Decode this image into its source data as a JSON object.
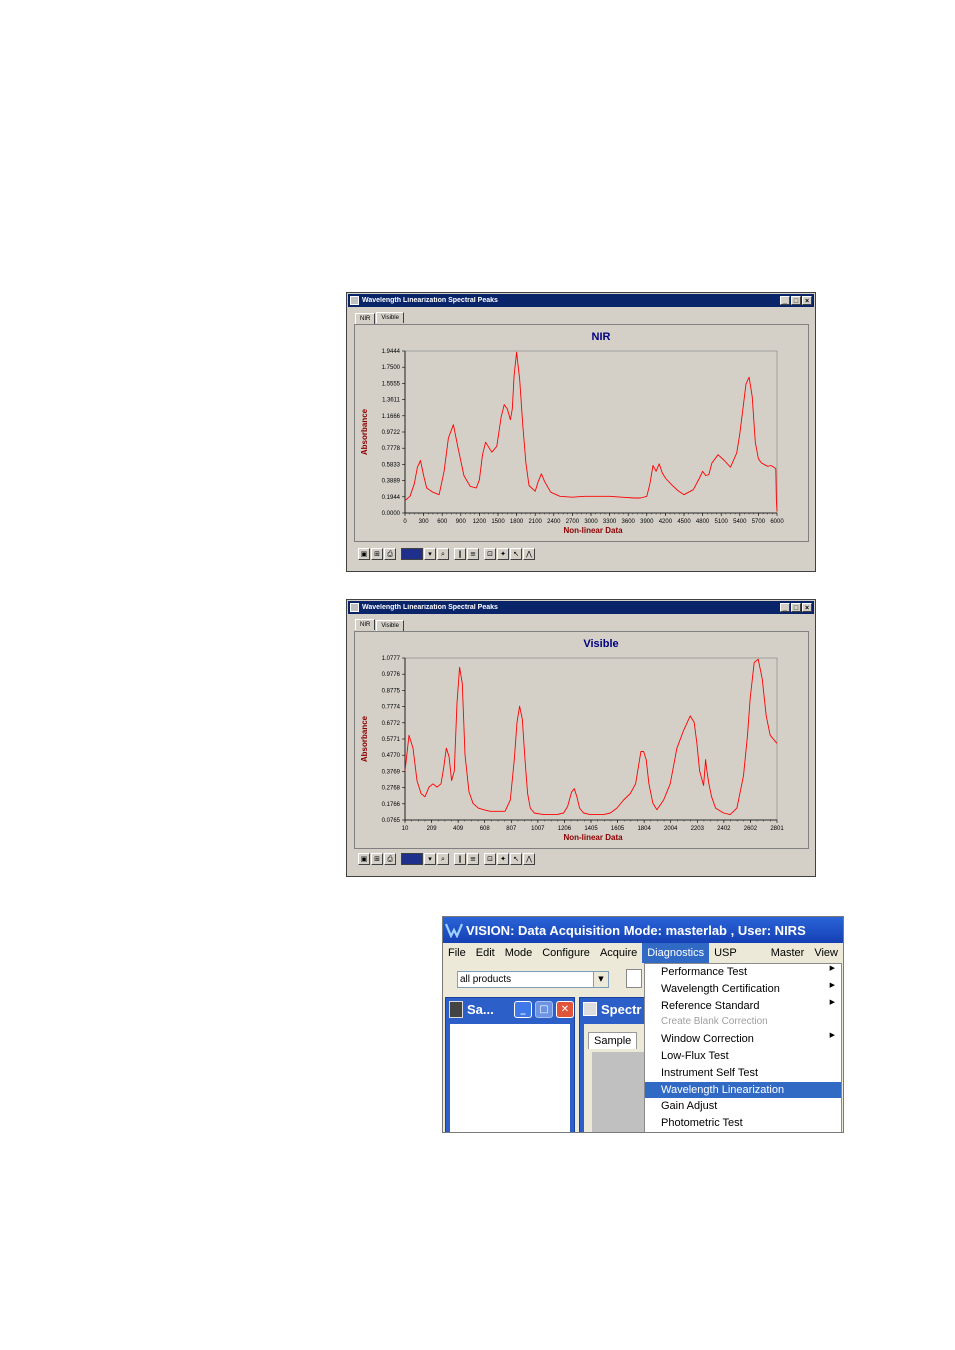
{
  "window_title": "Wavelength Linearization Spectral Peaks",
  "tabs": [
    "NIR",
    "Visible"
  ],
  "nir_chart": {
    "title": "NIR",
    "ylabel": "Absorbance",
    "xlabel": "Non-linear Data",
    "yticks": [
      "1.9444",
      "1.7500",
      "1.5555",
      "1.3611",
      "1.1666",
      "0.9722",
      "0.7778",
      "0.5833",
      "0.3889",
      "0.1944",
      "0.0000"
    ],
    "xticks": [
      "0",
      "300",
      "600",
      "900",
      "1200",
      "1500",
      "1800",
      "2100",
      "2400",
      "2700",
      "3000",
      "3300",
      "3600",
      "3900",
      "4200",
      "4500",
      "4800",
      "5100",
      "5400",
      "5700",
      "6000"
    ]
  },
  "visible_chart": {
    "title": "Visible",
    "ylabel": "Absorbance",
    "xlabel": "Non-linear Data",
    "yticks": [
      "1.0777",
      "0.9776",
      "0.8775",
      "0.7774",
      "0.6772",
      "0.5771",
      "0.4770",
      "0.3769",
      "0.2768",
      "0.1766",
      "0.0765"
    ],
    "xticks": [
      "10",
      "209",
      "409",
      "608",
      "807",
      "1007",
      "1206",
      "1405",
      "1605",
      "1804",
      "2004",
      "2203",
      "2402",
      "2602",
      "2801"
    ]
  },
  "chart_data": [
    {
      "type": "line",
      "title": "NIR",
      "xlabel": "Non-linear Data",
      "ylabel": "Absorbance",
      "xlim": [
        0,
        6000
      ],
      "ylim": [
        0,
        1.9444
      ],
      "grid": false,
      "series": [
        {
          "color": "#ff0000",
          "x": [
            0,
            80,
            150,
            200,
            250,
            300,
            350,
            450,
            550,
            630,
            700,
            780,
            850,
            950,
            1050,
            1150,
            1200,
            1250,
            1300,
            1400,
            1480,
            1550,
            1600,
            1650,
            1700,
            1730,
            1760,
            1800,
            1850,
            1900,
            1950,
            2000,
            2100,
            2150,
            2200,
            2250,
            2350,
            2500,
            2700,
            2900,
            3100,
            3300,
            3500,
            3700,
            3800,
            3900,
            3950,
            4000,
            4050,
            4100,
            4150,
            4200,
            4300,
            4400,
            4500,
            4650,
            4750,
            4800,
            4850,
            4900,
            4950,
            5050,
            5150,
            5250,
            5350,
            5400,
            5450,
            5500,
            5550,
            5600,
            5650,
            5700,
            5750,
            5800,
            5850,
            5900,
            5950,
            5980,
            5990,
            6000
          ],
          "y": [
            0.15,
            0.2,
            0.35,
            0.55,
            0.63,
            0.45,
            0.3,
            0.25,
            0.22,
            0.5,
            0.9,
            1.06,
            0.8,
            0.45,
            0.32,
            0.3,
            0.4,
            0.7,
            0.85,
            0.73,
            0.8,
            1.15,
            1.3,
            1.25,
            1.12,
            1.25,
            1.65,
            1.93,
            1.6,
            1.05,
            0.6,
            0.33,
            0.26,
            0.38,
            0.47,
            0.38,
            0.25,
            0.2,
            0.19,
            0.2,
            0.2,
            0.2,
            0.19,
            0.18,
            0.18,
            0.2,
            0.35,
            0.57,
            0.5,
            0.59,
            0.48,
            0.42,
            0.34,
            0.27,
            0.22,
            0.28,
            0.42,
            0.5,
            0.45,
            0.46,
            0.6,
            0.7,
            0.63,
            0.55,
            0.72,
            0.95,
            1.25,
            1.55,
            1.63,
            1.4,
            0.85,
            0.65,
            0.6,
            0.58,
            0.56,
            0.57,
            0.55,
            0.53,
            0.15,
            0.02
          ]
        }
      ]
    },
    {
      "type": "line",
      "title": "Visible",
      "xlabel": "Non-linear Data",
      "ylabel": "Absorbance",
      "xlim": [
        10,
        2801
      ],
      "ylim": [
        0.0765,
        1.0777
      ],
      "grid": false,
      "series": [
        {
          "color": "#ff0000",
          "x": [
            10,
            40,
            70,
            100,
            130,
            160,
            190,
            220,
            250,
            280,
            300,
            320,
            340,
            360,
            380,
            400,
            420,
            440,
            460,
            490,
            520,
            560,
            600,
            650,
            700,
            760,
            800,
            830,
            850,
            870,
            890,
            910,
            930,
            950,
            980,
            1050,
            1100,
            1150,
            1200,
            1230,
            1260,
            1280,
            1300,
            1320,
            1350,
            1400,
            1450,
            1500,
            1550,
            1600,
            1650,
            1700,
            1740,
            1780,
            1800,
            1820,
            1840,
            1870,
            1900,
            1950,
            2000,
            2050,
            2100,
            2150,
            2180,
            2200,
            2220,
            2250,
            2265,
            2275,
            2290,
            2310,
            2340,
            2400,
            2450,
            2500,
            2550,
            2580,
            2600,
            2630,
            2660,
            2690,
            2720,
            2750,
            2780,
            2801
          ],
          "y": [
            0.38,
            0.6,
            0.52,
            0.32,
            0.24,
            0.22,
            0.28,
            0.3,
            0.28,
            0.3,
            0.4,
            0.52,
            0.47,
            0.32,
            0.38,
            0.8,
            1.02,
            0.92,
            0.48,
            0.25,
            0.18,
            0.15,
            0.14,
            0.13,
            0.13,
            0.13,
            0.2,
            0.45,
            0.68,
            0.78,
            0.7,
            0.45,
            0.24,
            0.15,
            0.12,
            0.11,
            0.11,
            0.11,
            0.12,
            0.16,
            0.25,
            0.27,
            0.22,
            0.15,
            0.12,
            0.11,
            0.11,
            0.11,
            0.12,
            0.15,
            0.2,
            0.24,
            0.3,
            0.5,
            0.5,
            0.45,
            0.3,
            0.18,
            0.14,
            0.2,
            0.3,
            0.52,
            0.63,
            0.72,
            0.68,
            0.55,
            0.38,
            0.29,
            0.45,
            0.38,
            0.3,
            0.22,
            0.15,
            0.12,
            0.11,
            0.15,
            0.35,
            0.6,
            0.83,
            1.05,
            1.07,
            0.95,
            0.72,
            0.6,
            0.57,
            0.55
          ]
        }
      ]
    }
  ],
  "app": {
    "title": "VISION: Data Acquisition Mode: masterlab , User: NIRS",
    "menus": [
      "File",
      "Edit",
      "Mode",
      "Configure",
      "Acquire",
      "Diagnostics",
      "USP Tests",
      "Master",
      "View"
    ],
    "active_menu": "Diagnostics",
    "product_select": "all products",
    "child1_title": "Sa...",
    "child2_title": "Spectr",
    "sample_tab": "Sample",
    "dropdown_items": [
      {
        "label": "Performance Test",
        "submenu": true,
        "enabled": true
      },
      {
        "label": "Wavelength Certification",
        "submenu": true,
        "enabled": true
      },
      {
        "label": "Reference Standard",
        "submenu": true,
        "enabled": true
      },
      {
        "label": "Create Blank Correction",
        "submenu": false,
        "enabled": false
      },
      {
        "label": "Window Correction",
        "submenu": true,
        "enabled": true
      },
      {
        "label": "Low-Flux Test",
        "submenu": false,
        "enabled": true
      },
      {
        "label": "Instrument Self Test",
        "submenu": false,
        "enabled": true
      },
      {
        "label": "Wavelength Linearization",
        "submenu": false,
        "enabled": true,
        "selected": true
      },
      {
        "label": "Gain Adjust",
        "submenu": false,
        "enabled": true
      },
      {
        "label": "Photometric Test",
        "submenu": false,
        "enabled": true
      }
    ]
  },
  "colors": {
    "titlebar": "#0a246a",
    "curve": "#ff0000",
    "chart_title": "#000080",
    "axis_label": "#8b0000",
    "menu_highlight": "#316ac5"
  }
}
